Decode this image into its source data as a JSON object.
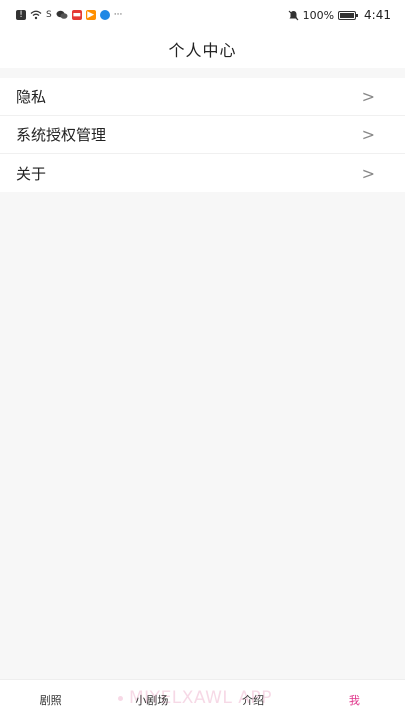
{
  "status_bar": {
    "battery": "100%",
    "time": "4:41",
    "icons": [
      "alert-icon",
      "wifi-icon",
      "s-icon",
      "wechat-icon",
      "red-app-icon",
      "orange-app-icon",
      "blue-app-icon",
      "more-icon",
      "mute-icon",
      "battery-icon"
    ]
  },
  "header": {
    "title": "个人中心"
  },
  "menu": {
    "items": [
      {
        "label": "隐私"
      },
      {
        "label": "系统授权管理"
      },
      {
        "label": "关于"
      }
    ],
    "chevron": ">"
  },
  "tabbar": {
    "tabs": [
      {
        "label": "剧照"
      },
      {
        "label": "小剧场"
      },
      {
        "label": "介绍"
      },
      {
        "label": "我"
      }
    ],
    "active_color": "#e0338a",
    "watermark": "MIYELXAWL APP"
  }
}
